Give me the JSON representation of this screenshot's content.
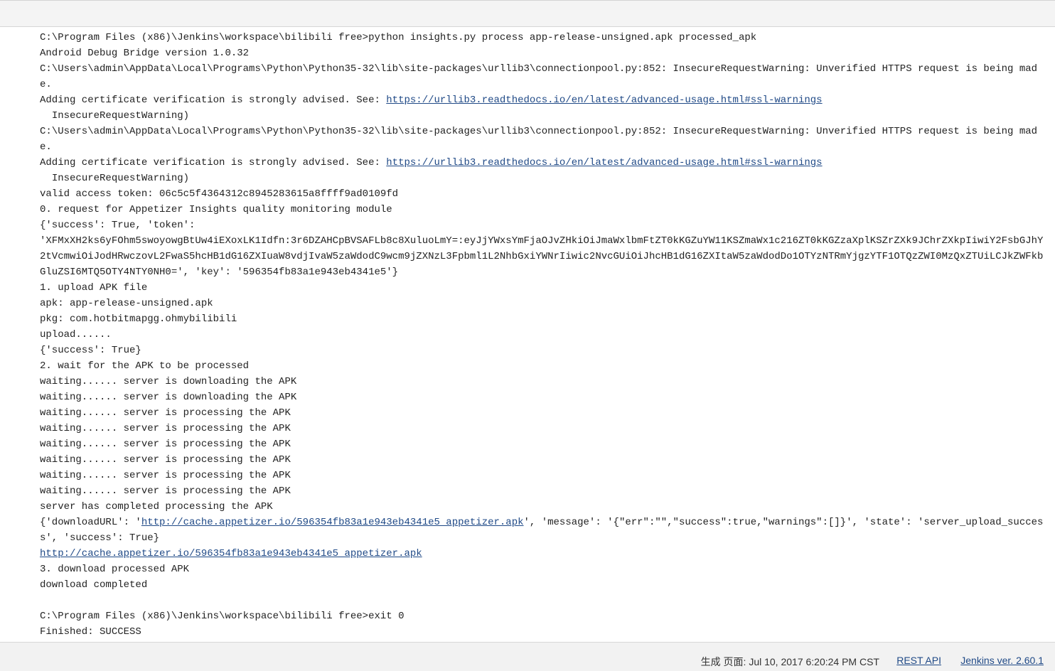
{
  "console": {
    "lines": [
      {
        "text": "C:\\Program Files (x86)\\Jenkins\\workspace\\bilibili free>python insights.py process app-release-unsigned.apk processed_apk"
      },
      {
        "text": "Android Debug Bridge version 1.0.32"
      },
      {
        "text": "C:\\Users\\admin\\AppData\\Local\\Programs\\Python\\Python35-32\\lib\\site-packages\\urllib3\\connectionpool.py:852: InsecureRequestWarning: Unverified HTTPS request is being made."
      },
      {
        "text": "Adding certificate verification is strongly advised. See: ",
        "link": "https://urllib3.readthedocs.io/en/latest/advanced-usage.html#ssl-warnings"
      },
      {
        "text": "  InsecureRequestWarning)"
      },
      {
        "text": "C:\\Users\\admin\\AppData\\Local\\Programs\\Python\\Python35-32\\lib\\site-packages\\urllib3\\connectionpool.py:852: InsecureRequestWarning: Unverified HTTPS request is being made."
      },
      {
        "text": "Adding certificate verification is strongly advised. See: ",
        "link": "https://urllib3.readthedocs.io/en/latest/advanced-usage.html#ssl-warnings"
      },
      {
        "text": "  InsecureRequestWarning)"
      },
      {
        "text": "valid access token: 06c5c5f4364312c8945283615a8ffff9ad0109fd"
      },
      {
        "text": "0. request for Appetizer Insights quality monitoring module"
      },
      {
        "text": "{'success': True, 'token':"
      },
      {
        "text": "'XFMxXH2ks6yFOhm5swoyowgBtUw4iEXoxLK1Idfn:3r6DZAHCpBVSAFLb8c8XuluoLmY=:eyJjYWxsYmFjaOJvZHkiOiJmaWxlbmFtZT0kKGZuYW11KSZmaWx1c216ZT0kKGZzaXplKSZrZXk9JChrZXkpIiwiY2FsbGJhY2tVcmwiOiJodHRwczovL2FwaS5hcHB1dG16ZXIuaW8vdjIvaW5zaWdodC9wcm9jZXNzL3Fpbml1L2NhbGxiYWNrIiwic2NvcGUiOiJhcHB1dG16ZXItaW5zaWdodDo1OTYzNTRmYjgzYTF1OTQzZWI0MzQxZTUiLCJkZWFkbGluZSI6MTQ5OTY4NTY0NH0=', 'key': '596354fb83a1e943eb4341e5'}"
      },
      {
        "text": "1. upload APK file"
      },
      {
        "text": "apk: app-release-unsigned.apk"
      },
      {
        "text": "pkg: com.hotbitmapgg.ohmybilibili"
      },
      {
        "text": "upload......"
      },
      {
        "text": "{'success': True}"
      },
      {
        "text": "2. wait for the APK to be processed"
      },
      {
        "text": "waiting...... server is downloading the APK"
      },
      {
        "text": "waiting...... server is downloading the APK"
      },
      {
        "text": "waiting...... server is processing the APK"
      },
      {
        "text": "waiting...... server is processing the APK"
      },
      {
        "text": "waiting...... server is processing the APK"
      },
      {
        "text": "waiting...... server is processing the APK"
      },
      {
        "text": "waiting...... server is processing the APK"
      },
      {
        "text": "waiting...... server is processing the APK"
      },
      {
        "text": "server has completed processing the APK"
      },
      {
        "text": "{'downloadURL': '",
        "link": "http://cache.appetizer.io/596354fb83a1e943eb4341e5_appetizer.apk",
        "after": "', 'message': '{\"err\":\"\",\"success\":true,\"warnings\":[]}', 'state': 'server_upload_success', 'success': True}"
      },
      {
        "text": "",
        "link": "http://cache.appetizer.io/596354fb83a1e943eb4341e5_appetizer.apk"
      },
      {
        "text": "3. download processed APK"
      },
      {
        "text": "download completed"
      },
      {
        "text": ""
      },
      {
        "text": "C:\\Program Files (x86)\\Jenkins\\workspace\\bilibili free>exit 0"
      },
      {
        "text": "Finished: SUCCESS"
      }
    ]
  },
  "footer": {
    "generated": "生成 页面: Jul 10, 2017 6:20:24 PM CST",
    "rest_api": "REST API",
    "jenkins_version": "Jenkins ver. 2.60.1"
  }
}
